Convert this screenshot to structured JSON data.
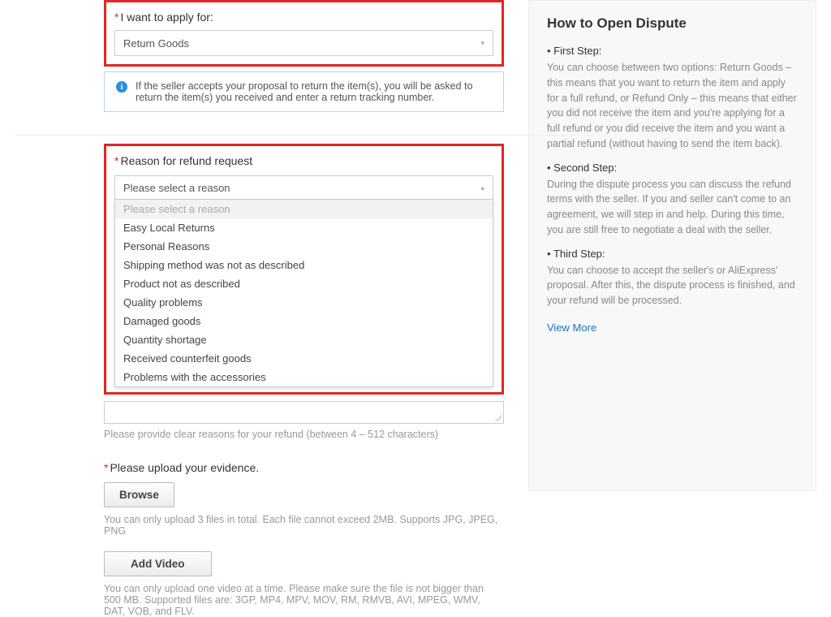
{
  "apply": {
    "label": "I want to apply for:",
    "value": "Return Goods"
  },
  "info_banner": "If the seller accepts your proposal to return the item(s), you will be asked to return the item(s) you received and enter a return tracking number.",
  "reason": {
    "label": "Reason for refund request",
    "selected": "Please select a reason",
    "options": [
      "Please select a reason",
      "Easy Local Returns",
      "Personal Reasons",
      "Shipping method was not as described",
      "Product not as described",
      "Quality problems",
      "Damaged goods",
      "Quantity shortage",
      "Received counterfeit goods",
      "Problems with the accessories"
    ]
  },
  "textarea_hint": "Please provide clear reasons for your refund (between 4 – 512 characters)",
  "evidence": {
    "title": "Please upload your evidence.",
    "browse": "Browse",
    "file_hint": "You can only upload 3 files in total. Each file cannot exceed 2MB. Supports JPG, JPEG, PNG",
    "add_video": "Add Video",
    "video_hint": "You can only upload one video at a time. Please make sure the file is not bigger than 500 MB. Supported files are: 3GP, MP4, MPV, MOV, RM, RMVB, AVI, MPEG, WMV, DAT, VOB, and FLV."
  },
  "sidebar": {
    "title": "How to Open Dispute",
    "steps": [
      {
        "label": "First Step:",
        "text": "You can choose between two options: Return Goods – this means that you want to return the item and apply for a full refund, or Refund Only – this means that either you did not receive the item and you're applying for a full refund or you did receive the item and you want a partial refund (without having to send the item back)."
      },
      {
        "label": "Second Step:",
        "text": "During the dispute process you can discuss the refund terms with the seller. If you and seller can't come to an agreement, we will step in and help. During this time, you are still free to negotiate a deal with the seller."
      },
      {
        "label": "Third Step:",
        "text": "You can choose to accept the seller's or AliExpress' proposal. After this, the dispute process is finished, and your refund will be processed."
      }
    ],
    "view_more": "View More"
  }
}
